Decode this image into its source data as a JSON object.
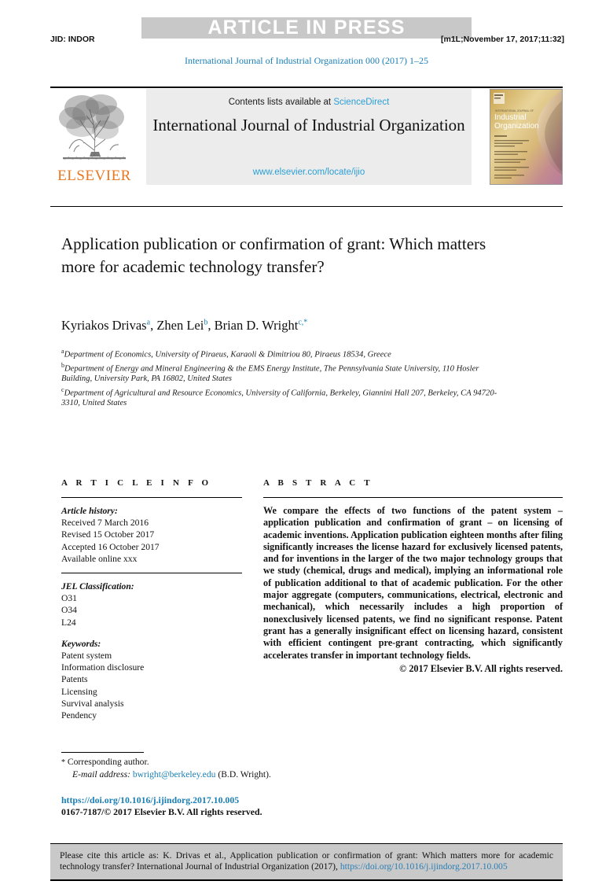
{
  "watermark": {
    "text": "ARTICLE IN PRESS"
  },
  "runhead": {
    "left": "JID: INDOR",
    "right": "[m1L;November 17, 2017;11:32]"
  },
  "journal_ref": "International Journal of Industrial Organization 000 (2017) 1–25",
  "masthead": {
    "publisher": "ELSEVIER",
    "contents_prefix": "Contents lists available at",
    "contents_link": "ScienceDirect",
    "journal_title": "International Journal of Industrial Organization",
    "journal_url": "www.elsevier.com/locate/ijio",
    "cover_title_small": "INTERNATIONAL JOURNAL OF",
    "cover_title": "Industrial Organization"
  },
  "article": {
    "title": "Application publication or confirmation of grant: Which matters more for academic technology transfer?",
    "authors": [
      {
        "name": "Kyriakos Drivas",
        "sup": "a"
      },
      {
        "name": "Zhen Lei",
        "sup": "b"
      },
      {
        "name": "Brian D. Wright",
        "sup": "c,*"
      }
    ],
    "affiliations": [
      {
        "label": "a",
        "text": "Department of Economics, University of Piraeus, Karaoli & Dimitriou 80, Piraeus 18534, Greece"
      },
      {
        "label": "b",
        "text": "Department of Energy and Mineral Engineering & the EMS Energy Institute, The Pennsylvania State University, 110 Hosler Building, University Park, PA 16802, United States"
      },
      {
        "label": "c",
        "text": "Department of Agricultural and Resource Economics, University of California, Berkeley, Giannini Hall 207, Berkeley, CA 94720-3310, United States"
      }
    ]
  },
  "info": {
    "heading": "A R T I C L E   I N F O",
    "history_label": "Article history:",
    "history": [
      "Received 7 March 2016",
      "Revised 15 October 2017",
      "Accepted 16 October 2017",
      "Available online xxx"
    ],
    "jel_label": "JEL Classification:",
    "jel": [
      "O31",
      "O34",
      "L24"
    ],
    "keywords_label": "Keywords:",
    "keywords": [
      "Patent system",
      "Information disclosure",
      "Patents",
      "Licensing",
      "Survival analysis",
      "Pendency"
    ]
  },
  "abstract": {
    "heading": "A B S T R A C T",
    "body": "We compare the effects of two functions of the patent system – application publication and confirmation of grant – on licensing of academic inventions. Application publication eighteen months after filing significantly increases the license hazard for exclusively licensed patents, and for inventions in the larger of the two major technology groups that we study (chemical, drugs and medical), implying an informational role of publication additional to that of academic publication. For the other major aggregate (computers, communications, electrical, electronic and mechanical), which necessarily includes a high proportion of nonexclusively licensed patents, we find no significant response. Patent grant has a generally insignificant effect on licensing hazard, consistent with efficient contingent pre-grant contracting, which significantly accelerates transfer in important technology fields.",
    "copyright": "© 2017 Elsevier B.V. All rights reserved."
  },
  "footer": {
    "corresponding_marker": "*",
    "corresponding_label": "Corresponding author.",
    "email_label": "E-mail address:",
    "email": "bwright@berkeley.edu",
    "email_owner": "(B.D. Wright).",
    "doi": "https://doi.org/10.1016/j.ijindorg.2017.10.005",
    "issn_line": "0167-7187/© 2017 Elsevier B.V. All rights reserved."
  },
  "cite_box": {
    "text": "Please cite this article as: K. Drivas et al., Application publication or confirmation of grant: Which matters more for academic technology transfer? International Journal of Industrial Organization (2017),",
    "link": "https://doi.org/10.1016/j.ijindorg.2017.10.005"
  },
  "colors": {
    "link_blue": "#1a7fb5",
    "sciencedirect_blue": "#2a9fd6",
    "elsevier_orange": "#e87722",
    "watermark_gray": "#c8c8c8",
    "band_gray": "#ececec",
    "cite_gray": "#c9c9c9"
  }
}
